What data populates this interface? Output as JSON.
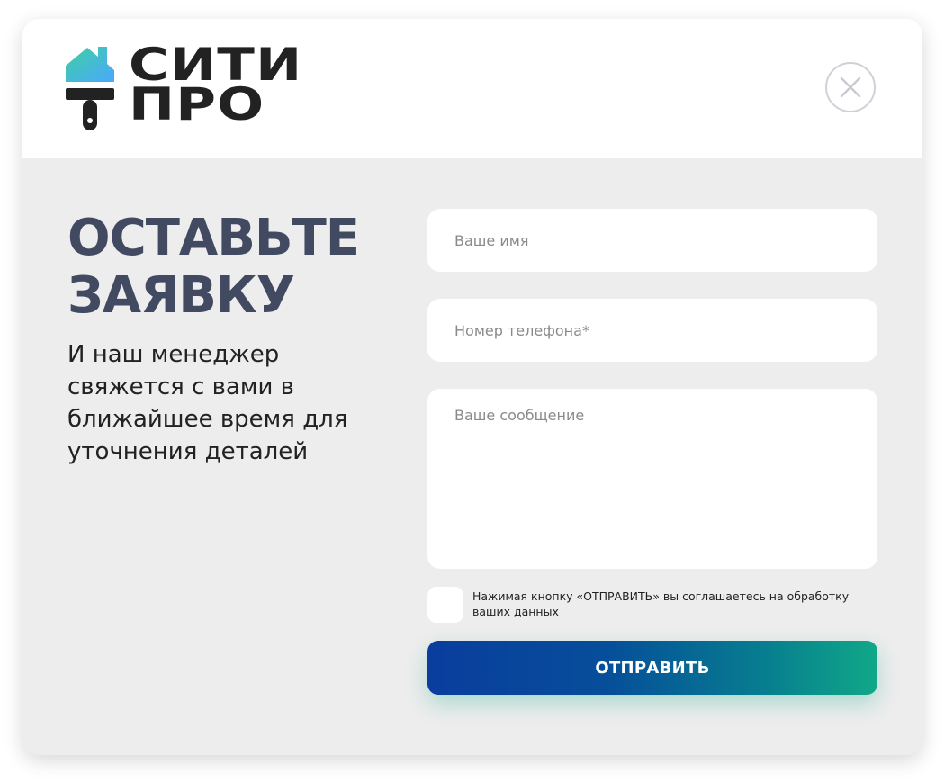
{
  "logo": {
    "line1": "СИТИ",
    "line2": "ПРО",
    "icon": "house-paint-roller-icon"
  },
  "close_icon": "close-icon",
  "title": {
    "line1": "ОСТАВЬТЕ",
    "line2": "ЗАЯВКУ"
  },
  "subtitle": "И наш менеджер свяжется с вами в ближайшее время для уточнения деталей",
  "form": {
    "name_placeholder": "Ваше имя",
    "phone_placeholder": "Номер телефона*",
    "message_placeholder": "Ваше сообщение",
    "consent_text": "Нажимая кнопку «ОТПРАВИТЬ» вы соглашаетесь на обработку ваших данных",
    "submit_label": "ОТПРАВИТЬ"
  },
  "colors": {
    "title": "#424a62",
    "button_start": "#0a3d9e",
    "button_end": "#10a888",
    "panel_bg": "#ededed"
  }
}
